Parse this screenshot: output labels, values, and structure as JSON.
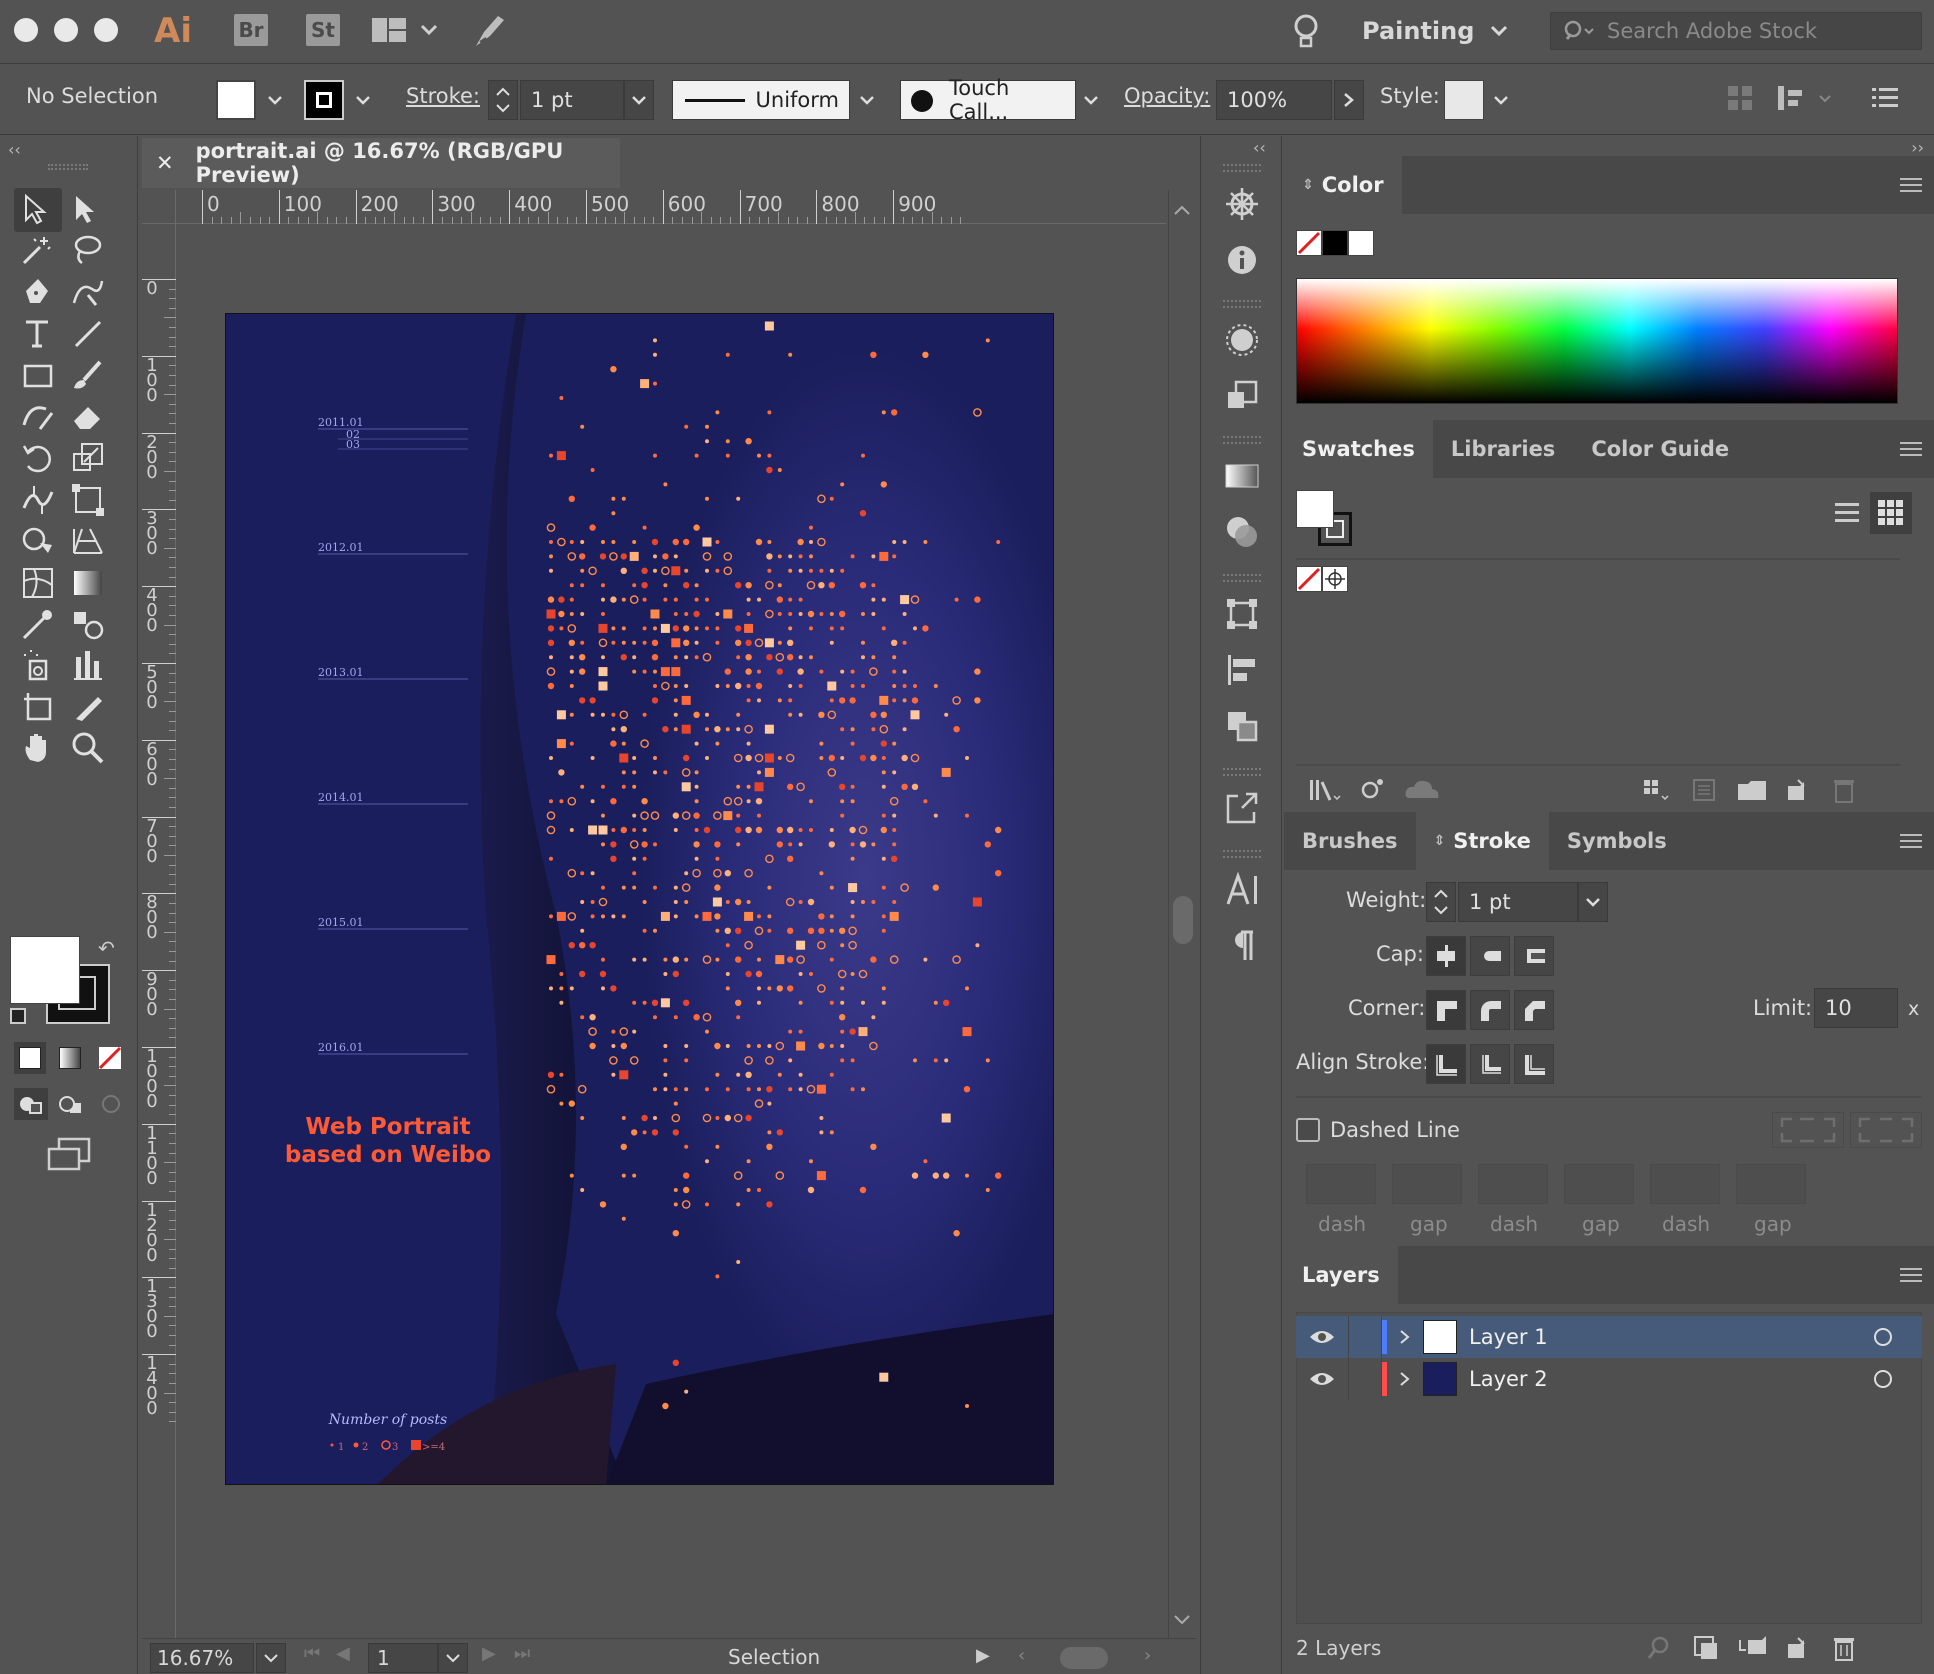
{
  "app": {
    "logo": "Ai",
    "bridge": "Br",
    "stock": "St",
    "workspace": "Painting",
    "search_placeholder": "Search Adobe Stock"
  },
  "control": {
    "selection": "No Selection",
    "stroke_label": "Stroke:",
    "stroke_value": "1 pt",
    "profile": "Uniform",
    "brush": "Touch Call...",
    "opacity_label": "Opacity:",
    "opacity_value": "100%",
    "style_label": "Style:"
  },
  "document": {
    "tab_title": "portrait.ai @ 16.67% (RGB/GPU Preview)",
    "hruler": [
      "0",
      "100",
      "200",
      "300",
      "400",
      "500",
      "600",
      "700",
      "800",
      "900"
    ],
    "vruler": [
      "0",
      "100",
      "200",
      "300",
      "400",
      "500",
      "600",
      "700",
      "800",
      "900",
      "1000",
      "1100",
      "1200",
      "1300",
      "1400"
    ]
  },
  "artwork": {
    "timeline": [
      {
        "label": "2011.01",
        "sub": [
          "02",
          "03"
        ]
      },
      {
        "label": "2012.01"
      },
      {
        "label": "2013.01"
      },
      {
        "label": "2014.01"
      },
      {
        "label": "2015.01"
      },
      {
        "label": "2016.01"
      }
    ],
    "title_line1": "Web Portrait",
    "title_line2": "based on Weibo",
    "legend_title": "Number of posts",
    "legend": [
      "1",
      "2",
      "3",
      ">=4"
    ],
    "colors": {
      "background": "#1b1e5c",
      "accent": "#e8452c",
      "dots": "#ff8a4a",
      "timeline": "#9a9ee8"
    }
  },
  "status": {
    "zoom": "16.67%",
    "page": "1",
    "mode": "Selection"
  },
  "panels": {
    "color": {
      "title": "Color"
    },
    "swatches": {
      "tabs": [
        "Swatches",
        "Libraries",
        "Color Guide"
      ]
    },
    "stroke": {
      "tabs": [
        "Brushes",
        "Stroke",
        "Symbols"
      ],
      "weight_label": "Weight:",
      "weight_value": "1 pt",
      "cap_label": "Cap:",
      "corner_label": "Corner:",
      "limit_label": "Limit:",
      "limit_value": "10",
      "limit_unit": "x",
      "align_label": "Align Stroke:",
      "dashed_label": "Dashed Line",
      "dash_fields": [
        "dash",
        "gap",
        "dash",
        "gap",
        "dash",
        "gap"
      ]
    },
    "layers": {
      "title": "Layers",
      "items": [
        {
          "name": "Layer 1",
          "color": "#4d7cff"
        },
        {
          "name": "Layer 2",
          "color": "#ff4d4d"
        }
      ],
      "count": "2 Layers"
    }
  }
}
